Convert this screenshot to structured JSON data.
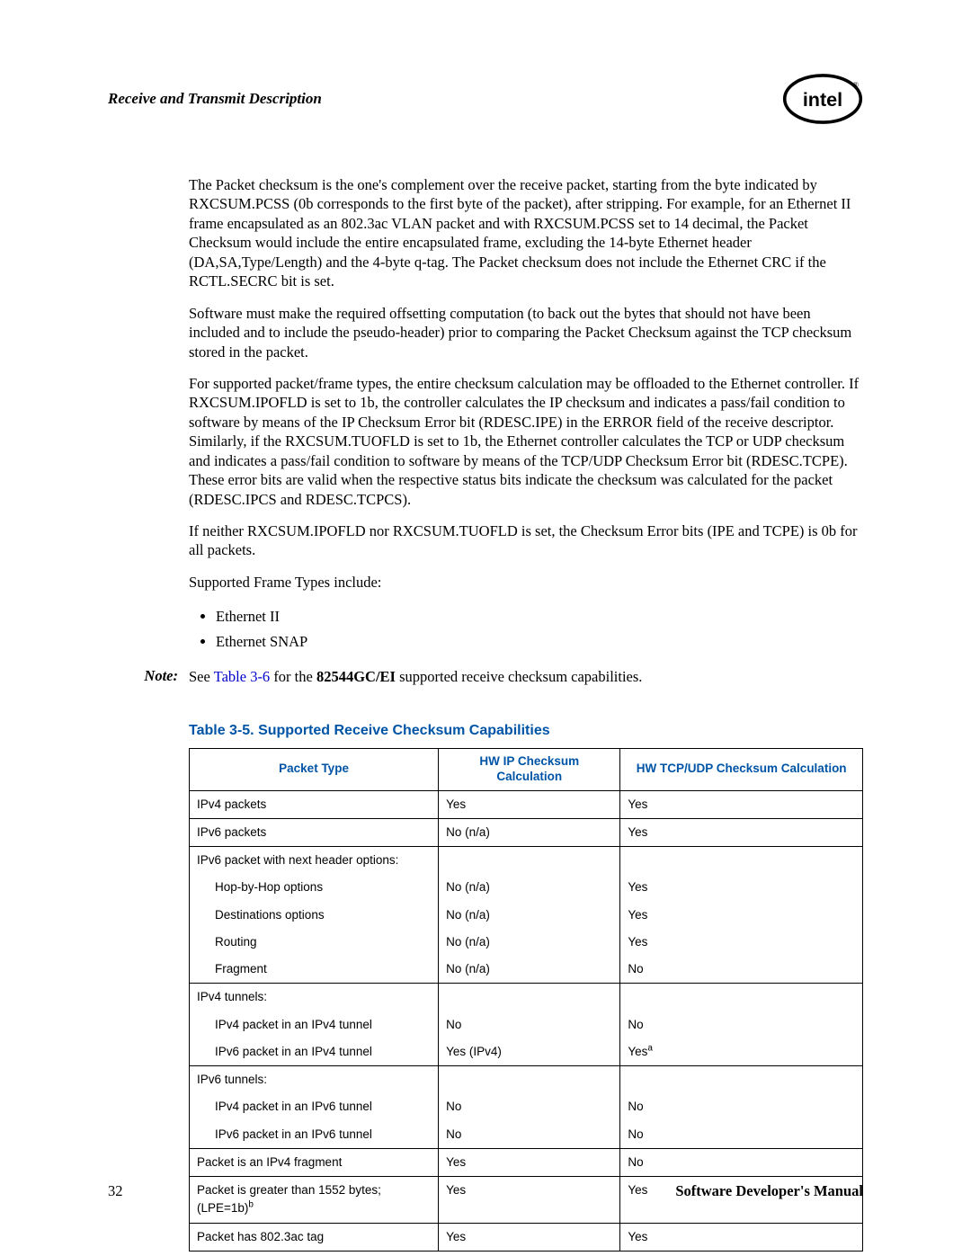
{
  "header": {
    "section": "Receive and Transmit Description",
    "logo_name": "intel-logo"
  },
  "paragraphs": {
    "p1": "The Packet checksum is the one's complement over the receive packet, starting from the byte indicated by RXCSUM.PCSS (0b corresponds to the first byte of the packet), after stripping. For example, for an Ethernet II frame encapsulated as an 802.3ac VLAN packet and with RXCSUM.PCSS set to 14 decimal, the Packet Checksum would include the entire encapsulated frame, excluding the 14-byte Ethernet header (DA,SA,Type/Length) and the 4-byte q-tag. The Packet checksum does not include the Ethernet CRC if the RCTL.SECRC bit is set.",
    "p2": "Software must make the required offsetting computation (to back out the bytes that should not have been included and to include the pseudo-header) prior to comparing the Packet Checksum against the TCP checksum stored in the packet.",
    "p3": "For supported packet/frame types, the entire checksum calculation may be offloaded to the Ethernet controller. If RXCSUM.IPOFLD is set to 1b, the controller calculates the IP checksum and indicates a pass/fail condition to software by means of the IP Checksum Error bit (RDESC.IPE) in the ERROR field of the receive descriptor. Similarly, if the RXCSUM.TUOFLD is set to 1b, the Ethernet controller calculates the TCP or UDP checksum and indicates a pass/fail condition to software by means of the TCP/UDP Checksum Error bit (RDESC.TCPE). These error bits are valid when the respective status bits indicate the checksum was calculated for the packet (RDESC.IPCS and RDESC.TCPCS).",
    "p4": "If neither RXCSUM.IPOFLD nor RXCSUM.TUOFLD is set, the Checksum Error bits (IPE and TCPE) is 0b for all packets.",
    "p5": "Supported Frame Types include:",
    "bullets": [
      "Ethernet II",
      "Ethernet SNAP"
    ]
  },
  "note": {
    "label": "Note:",
    "pre": "See ",
    "xref": "Table 3-6",
    "mid": " for the ",
    "bold": "82544GC/EI",
    "post": " supported receive checksum capabilities."
  },
  "table": {
    "caption": "Table 3-5. Supported Receive Checksum Capabilities",
    "headers": [
      "Packet Type",
      "HW IP Checksum Calculation",
      "HW TCP/UDP Checksum Calculation"
    ],
    "rows": [
      {
        "sep": true,
        "cells": [
          "IPv4 packets",
          "Yes",
          "Yes"
        ]
      },
      {
        "sep": true,
        "cells": [
          "IPv6 packets",
          "No (n/a)",
          "Yes"
        ]
      },
      {
        "sep": true,
        "cells": [
          "IPv6 packet with next header options:",
          "",
          ""
        ]
      },
      {
        "sub": true,
        "cells": [
          "Hop-by-Hop options",
          "No (n/a)",
          "Yes"
        ]
      },
      {
        "sub": true,
        "cells": [
          "Destinations options",
          "No (n/a)",
          "Yes"
        ]
      },
      {
        "sub": true,
        "cells": [
          "Routing",
          "No (n/a)",
          "Yes"
        ]
      },
      {
        "sub": true,
        "cells": [
          "Fragment",
          "No (n/a)",
          "No"
        ]
      },
      {
        "sep": true,
        "cells": [
          "IPv4 tunnels:",
          "",
          ""
        ]
      },
      {
        "sub": true,
        "cells": [
          "IPv4 packet in an IPv4 tunnel",
          "No",
          "No"
        ]
      },
      {
        "sub": true,
        "cells": [
          "IPv6 packet in an IPv4 tunnel",
          "Yes (IPv4)",
          "Yes",
          "a"
        ]
      },
      {
        "sep": true,
        "cells": [
          "IPv6 tunnels:",
          "",
          ""
        ]
      },
      {
        "sub": true,
        "cells": [
          "IPv4 packet in an IPv6 tunnel",
          "No",
          "No"
        ]
      },
      {
        "sub": true,
        "cells": [
          "IPv6 packet in an IPv6 tunnel",
          "No",
          "No"
        ]
      },
      {
        "sep": true,
        "cells": [
          "Packet is an IPv4 fragment",
          "Yes",
          "No"
        ]
      },
      {
        "sep": true,
        "cells": [
          "Packet is greater than 1552 bytes; (LPE=1b)",
          "Yes",
          "Yes"
        ],
        "sup0": "b"
      },
      {
        "sep": true,
        "last": true,
        "cells": [
          "Packet has 802.3ac tag",
          "Yes",
          "Yes"
        ]
      }
    ]
  },
  "footer": {
    "page": "32",
    "manual": "Software Developer's Manual"
  }
}
